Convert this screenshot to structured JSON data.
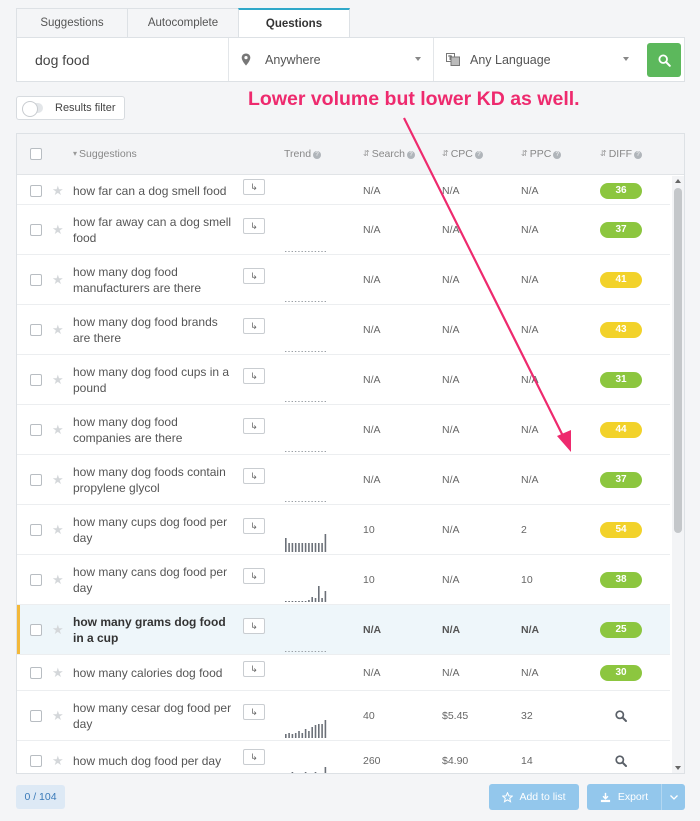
{
  "tabs": [
    {
      "label": "Suggestions"
    },
    {
      "label": "Autocomplete"
    },
    {
      "label": "Questions"
    }
  ],
  "search": {
    "query": "dog food",
    "location": "Anywhere",
    "language": "Any Language"
  },
  "filter": {
    "label": "Results filter"
  },
  "annotation": "Lower volume but lower KD as well.",
  "table": {
    "headers": {
      "suggestions": "Suggestions",
      "trend": "Trend",
      "search": "Search",
      "cpc": "CPC",
      "ppc": "PPC",
      "diff": "DIFF"
    },
    "rows": [
      {
        "keyword": "how far can a dog smell food",
        "search": "N/A",
        "cpc": "N/A",
        "ppc": "N/A",
        "diff": "36",
        "trend": []
      },
      {
        "keyword": "how far away can a dog smell food",
        "search": "N/A",
        "cpc": "N/A",
        "ppc": "N/A",
        "diff": "37",
        "trend": []
      },
      {
        "keyword": "how many dog food manufacturers are there",
        "search": "N/A",
        "cpc": "N/A",
        "ppc": "N/A",
        "diff": "41",
        "trend": []
      },
      {
        "keyword": "how many dog food brands are there",
        "search": "N/A",
        "cpc": "N/A",
        "ppc": "N/A",
        "diff": "43",
        "trend": []
      },
      {
        "keyword": "how many dog food cups in a pound",
        "search": "N/A",
        "cpc": "N/A",
        "ppc": "N/A",
        "diff": "31",
        "trend": []
      },
      {
        "keyword": "how many dog food companies are there",
        "search": "N/A",
        "cpc": "N/A",
        "ppc": "N/A",
        "diff": "44",
        "trend": []
      },
      {
        "keyword": "how many dog foods contain propylene glycol",
        "search": "N/A",
        "cpc": "N/A",
        "ppc": "N/A",
        "diff": "37",
        "trend": []
      },
      {
        "keyword": "how many cups dog food per day",
        "search": "10",
        "cpc": "N/A",
        "ppc": "2",
        "diff": "54",
        "trend": [
          0.8,
          0.5,
          0.5,
          0.5,
          0.5,
          0.5,
          0.5,
          0.5,
          0.5,
          0.5,
          0.5,
          0.5,
          1.0
        ]
      },
      {
        "keyword": "how many cans dog food per day",
        "search": "10",
        "cpc": "N/A",
        "ppc": "10",
        "diff": "38",
        "trend": [
          0,
          0,
          0,
          0,
          0,
          0,
          0,
          0.1,
          0.3,
          0.2,
          0.9,
          0.2,
          0.6
        ]
      },
      {
        "keyword": "how many grams dog food in a cup",
        "search": "N/A",
        "cpc": "N/A",
        "ppc": "N/A",
        "diff": "25",
        "trend": [],
        "highlight": true
      },
      {
        "keyword": "how many calories dog food",
        "search": "N/A",
        "cpc": "N/A",
        "ppc": "N/A",
        "diff": "30",
        "trend": []
      },
      {
        "keyword": "how many cesar dog food per day",
        "search": "40",
        "cpc": "$5.45",
        "ppc": "32",
        "diff": "",
        "trend": [
          0.2,
          0.3,
          0.2,
          0.3,
          0.4,
          0.3,
          0.5,
          0.4,
          0.6,
          0.7,
          0.8,
          0.8,
          1.0
        ]
      },
      {
        "keyword": "how much dog food per day",
        "search": "260",
        "cpc": "$4.90",
        "ppc": "14",
        "diff": "",
        "trend": [
          0.4,
          0.5,
          0.6,
          0.5,
          0.3,
          0.4,
          0.6,
          0.4,
          0.5,
          0.6,
          0.4,
          0.5,
          0.9
        ]
      }
    ]
  },
  "footer": {
    "count": "0 / 104",
    "add_to_list": "Add to list",
    "export": "Export"
  },
  "colors": {
    "diff_green": "#8cc63f",
    "diff_yellow": "#f2d22a",
    "accent": "#2fa8c9",
    "annotation": "#ee2a6e"
  }
}
